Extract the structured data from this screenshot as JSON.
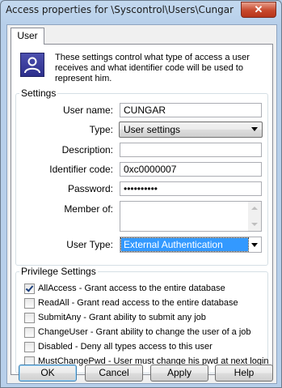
{
  "window": {
    "title": "Access properties for \\Syscontrol\\Users\\Cungar",
    "close_label": "✕"
  },
  "tab": {
    "label": "User"
  },
  "intro": "These settings control what type of access a user receives and what identifier code will be used to represent him.",
  "settings": {
    "legend": "Settings",
    "user_name_label": "User name:",
    "user_name_value": "CUNGAR",
    "type_label": "Type:",
    "type_value": "User settings",
    "description_label": "Description:",
    "description_value": "",
    "identifier_label": "Identifier code:",
    "identifier_value": "0xc0000007",
    "password_label": "Password:",
    "password_value": "••••••••••",
    "member_of_label": "Member of:",
    "user_type_label": "User Type:",
    "user_type_value": "External Authentication"
  },
  "privileges": {
    "legend": "Privilege Settings",
    "items": [
      {
        "label": "AllAccess - Grant access to the entire database",
        "checked": true
      },
      {
        "label": "ReadAll - Grant read access to the entire database",
        "checked": false
      },
      {
        "label": "SubmitAny - Grant ability to submit any job",
        "checked": false
      },
      {
        "label": "ChangeUser - Grant ability to change the user of a job",
        "checked": false
      },
      {
        "label": "Disabled - Deny all types access to this user",
        "checked": false
      },
      {
        "label": "MustChangePwd - User must change his pwd at next login",
        "checked": false
      }
    ]
  },
  "buttons": {
    "ok": "OK",
    "cancel": "Cancel",
    "apply": "Apply",
    "help": "Help"
  }
}
